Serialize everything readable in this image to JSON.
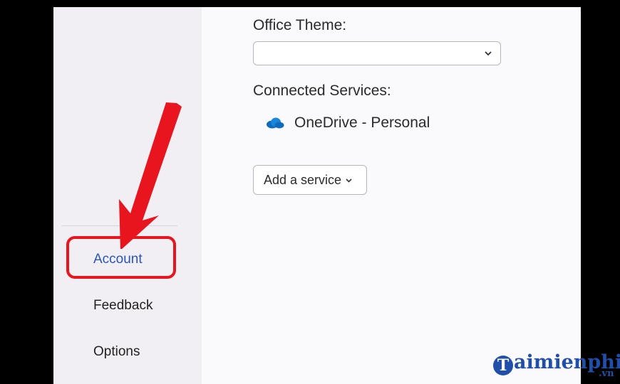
{
  "sidebar": {
    "items": [
      {
        "label": "Account",
        "active": true
      },
      {
        "label": "Feedback",
        "active": false
      },
      {
        "label": "Options",
        "active": false
      }
    ]
  },
  "main": {
    "office_theme": {
      "label": "Office Theme:",
      "selected_value": ""
    },
    "connected_services": {
      "label": "Connected Services:",
      "services": [
        {
          "name": "OneDrive - Personal",
          "icon": "onedrive-cloud-icon"
        }
      ]
    },
    "add_service_button": "Add a service"
  },
  "annotation": {
    "arrow_color": "#e8151f",
    "highlight_color": "#e8151f"
  },
  "watermark": {
    "brand_initial": "T",
    "brand_text": "aimienphi",
    "brand_suffix": ".vn",
    "brand_color": "#1f4fa8"
  }
}
